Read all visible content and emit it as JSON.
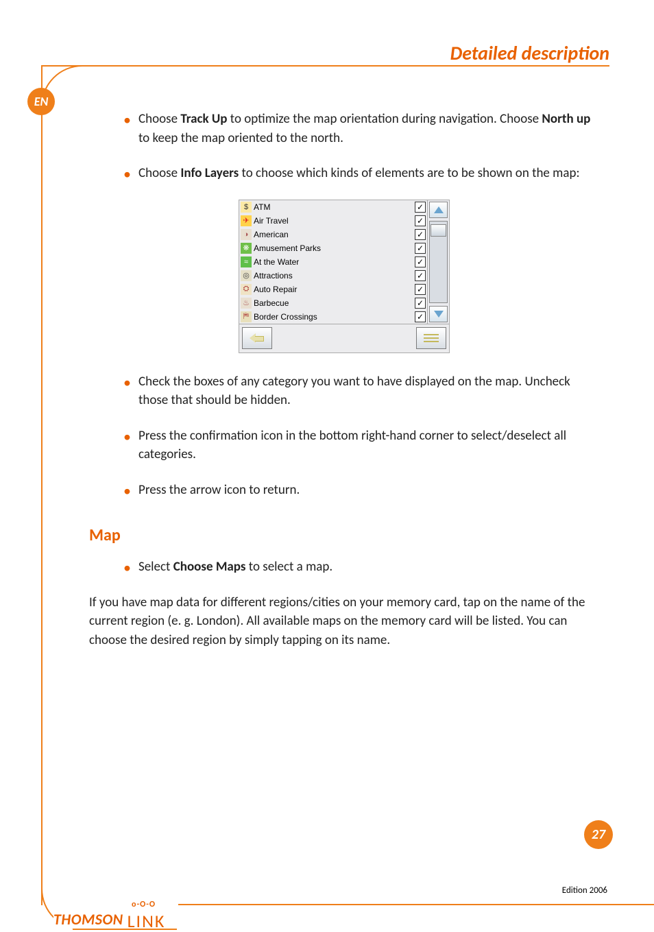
{
  "header": {
    "title": "Detailed description"
  },
  "lang_badge": "EN",
  "page_number": "27",
  "edition": "Edition 2006",
  "logo": {
    "brand": "THOMSON",
    "suffix": "LINK",
    "dots": "o-O-O"
  },
  "bullets_top": [
    {
      "pre": "Choose ",
      "b1": "Track Up",
      "mid": " to optimize the map orientation during navigation. Choose ",
      "b2": "North up",
      "post": " to keep the map oriented to the north."
    },
    {
      "pre": "Choose ",
      "b1": "Info Layers",
      "mid": " to choose which kinds of elements are to be shown on the map:",
      "b2": "",
      "post": ""
    }
  ],
  "info_layers": {
    "items": [
      {
        "label": "ATM",
        "checked": true,
        "icon": "atm"
      },
      {
        "label": "Air Travel",
        "checked": true,
        "icon": "plane"
      },
      {
        "label": "American",
        "checked": true,
        "icon": "tbl"
      },
      {
        "label": "Amusement Parks",
        "checked": true,
        "icon": "park"
      },
      {
        "label": "At the Water",
        "checked": true,
        "icon": "water"
      },
      {
        "label": "Attractions",
        "checked": true,
        "icon": "attr"
      },
      {
        "label": "Auto Repair",
        "checked": true,
        "icon": "auto"
      },
      {
        "label": "Barbecue",
        "checked": true,
        "icon": "bbq"
      },
      {
        "label": "Border Crossings",
        "checked": true,
        "icon": "border"
      }
    ]
  },
  "bullets_mid": [
    "Check the boxes of any category you want to have displayed on the map. Uncheck those that should be hidden.",
    "Press the confirmation icon in the bottom right-hand corner to select/deselect all categories.",
    "Press the arrow icon to return."
  ],
  "section_map": {
    "heading": "Map",
    "bullet": {
      "pre": "Select ",
      "b1": "Choose Maps",
      "post": " to select a map."
    },
    "para": "If you have map data for different regions/cities on your memory card, tap on the name of the current region (e. g. London). All available maps on the memory card will be listed. You can choose the desired region by simply tapping on its name."
  },
  "icons": {
    "atm": "$",
    "plane": "✈",
    "tbl": "◑",
    "park": "❋",
    "water": "≈",
    "attr": "◎",
    "auto": "⛭",
    "bbq": "♨",
    "border": "⛿",
    "check": "✓"
  }
}
